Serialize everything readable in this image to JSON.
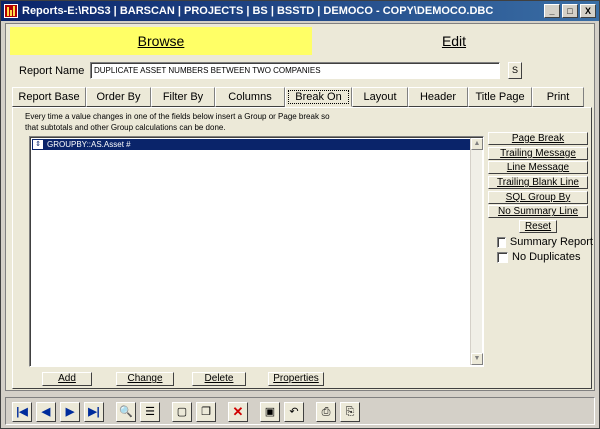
{
  "window": {
    "title": "Reports-E:\\RDS3 | BARSCAN | PROJECTS | BS | BSSTD | DEMOCO - COPY\\DEMOCO.DBC",
    "min": "_",
    "max": "□",
    "close": "X"
  },
  "modes": {
    "browse": "Browse",
    "edit": "Edit"
  },
  "report": {
    "label": "Report Name",
    "value": "DUPLICATE ASSET NUMBERS BETWEEN TWO COMPANIES",
    "search_btn": "S"
  },
  "tabs": [
    "Report Base",
    "Order By",
    "Filter By",
    "Columns",
    "Break On",
    "Layout",
    "Header",
    "Title Page",
    "Print"
  ],
  "break_on": {
    "instructions": "Every time a value changes in one of the fields below insert a Group or Page break so that subtotals and other Group calculations can be done.",
    "rows": [
      {
        "grip": "⇕",
        "text": "GROUPBY::AS.Asset #"
      }
    ],
    "scroll_up": "▲",
    "scroll_down": "▼"
  },
  "side_buttons": {
    "page_break": "Page Break",
    "trailing_message": "Trailing Message",
    "line_message": "Line Message",
    "trailing_blank_line": "Trailing Blank Line",
    "sql_group_by": "SQL Group By",
    "no_summary_line": "No Summary Line",
    "reset": "Reset"
  },
  "checks": {
    "summary_report": "Summary Report",
    "no_duplicates": "No Duplicates"
  },
  "bottom_buttons": {
    "add": "Add",
    "change": "Change",
    "delete": "Delete",
    "properties": "Properties"
  },
  "toolbar": {
    "first": "|◀",
    "prev": "◀",
    "next": "▶",
    "last": "▶|",
    "find": "🔍",
    "list": "☰",
    "new": "▢",
    "copy": "❐",
    "delete": "✕",
    "save": "▣",
    "undo": "↶",
    "print": "⎙",
    "preview": "⎘"
  }
}
